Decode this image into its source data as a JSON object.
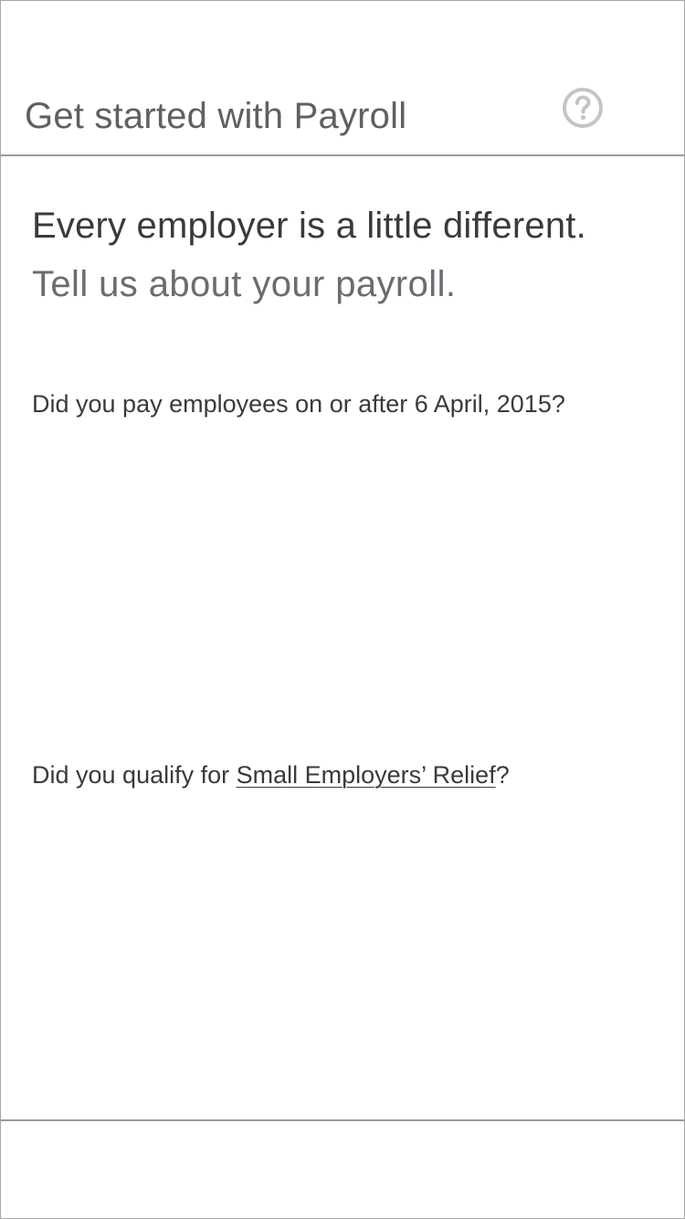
{
  "header": {
    "title": "Get started with Payroll",
    "help_icon": "question-circle-icon"
  },
  "main": {
    "headline": "Every employer is a little different.",
    "subheadline": "Tell us about your payroll.",
    "question_1": "Did you pay employees on or after 6 April, 2015?",
    "question_2": {
      "prefix": "Did you qualify for ",
      "link": "Small Employers’ Relief",
      "suffix": "?"
    }
  },
  "colors": {
    "text_dark": "#393a3d",
    "text_light": "#6b6c72",
    "border": "#9a9a9a",
    "icon": "#c4c4c4"
  }
}
